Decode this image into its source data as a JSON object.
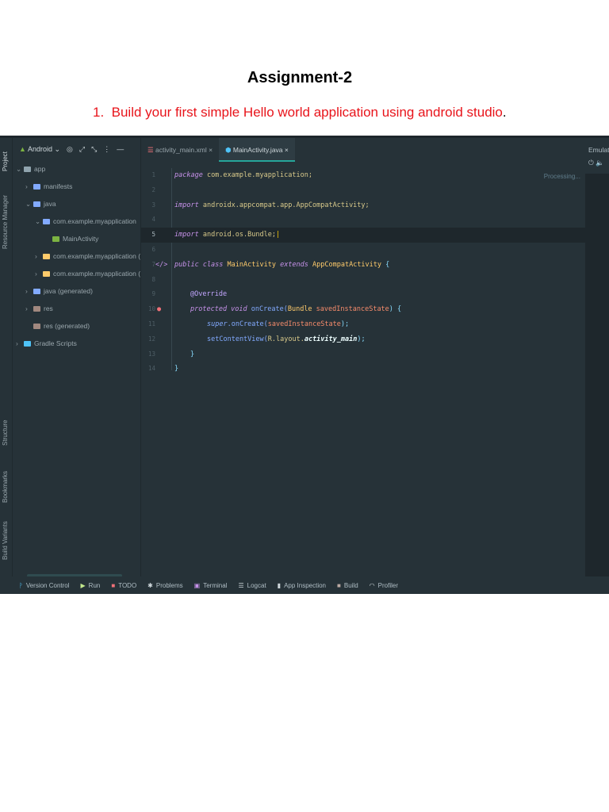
{
  "document": {
    "title": "Assignment-2",
    "task_number": "1.",
    "task_text": "Build your first simple Hello world application using android studio",
    "task_end": "."
  },
  "ide": {
    "left_strip": [
      "Project",
      "Resource Manager",
      "Structure",
      "Bookmarks",
      "Build Variants"
    ],
    "project_view": "Android",
    "tree": [
      {
        "label": "app",
        "depth": 0,
        "icon": "module",
        "color": "#90a4ae",
        "chev": "v"
      },
      {
        "label": "manifests",
        "depth": 1,
        "icon": "folder",
        "color": "#82aaff",
        "chev": ">"
      },
      {
        "label": "java",
        "depth": 1,
        "icon": "folder",
        "color": "#82aaff",
        "chev": "v"
      },
      {
        "label": "com.example.myapplication",
        "depth": 2,
        "icon": "package",
        "color": "#82aaff",
        "chev": "v"
      },
      {
        "label": "MainActivity",
        "depth": 3,
        "icon": "android",
        "color": "#7cb342",
        "chev": ""
      },
      {
        "label": "com.example.myapplication (",
        "depth": 2,
        "icon": "folder",
        "color": "#ffcb6b",
        "chev": ">"
      },
      {
        "label": "com.example.myapplication (",
        "depth": 2,
        "icon": "folder",
        "color": "#ffcb6b",
        "chev": ">"
      },
      {
        "label": "java (generated)",
        "depth": 1,
        "icon": "folder",
        "color": "#82aaff",
        "chev": ">"
      },
      {
        "label": "res",
        "depth": 1,
        "icon": "res-folder",
        "color": "#a1887f",
        "chev": ">"
      },
      {
        "label": "res (generated)",
        "depth": 1,
        "icon": "res-folder",
        "color": "#a1887f",
        "chev": ""
      },
      {
        "label": "Gradle Scripts",
        "depth": 0,
        "icon": "gradle",
        "color": "#4fc3f7",
        "chev": ">"
      }
    ],
    "tabs": [
      {
        "label": "activity_main.xml",
        "active": false
      },
      {
        "label": "MainActivity.java",
        "active": true
      }
    ],
    "status": "Processing...",
    "emulator": "Emulat",
    "code": {
      "l1": [
        "package",
        " com.example.myapplication;"
      ],
      "l3": [
        "import",
        " androidx.appcompat.app.AppCompatActivity;"
      ],
      "l5": [
        "import",
        " android.os.Bundle;"
      ],
      "l7": [
        "public class",
        " MainActivity ",
        "extends",
        " AppCompatActivity ",
        "{"
      ],
      "l9": "@Override",
      "l10": [
        "protected void",
        " onCreate(",
        "Bundle",
        " savedInstanceState",
        ") {"
      ],
      "l11": [
        "super",
        ".onCreate(",
        "savedInstanceState",
        ");"
      ],
      "l12": [
        "setContentView(",
        "R.layout.",
        "activity_main",
        ");"
      ],
      "l13": "}",
      "l14": "}"
    },
    "bottom": [
      {
        "icon": "version-control",
        "glyph": "ᚹ",
        "label": "Version Control",
        "color": "#4fc3f7"
      },
      {
        "icon": "run",
        "glyph": "▶",
        "label": "Run",
        "color": "#c3e88d"
      },
      {
        "icon": "todo",
        "glyph": "■",
        "label": "TODO",
        "color": "#f07178"
      },
      {
        "icon": "problems",
        "glyph": "✱",
        "label": "Problems",
        "color": "#cfd8dc"
      },
      {
        "icon": "terminal",
        "glyph": "▣",
        "label": "Terminal",
        "color": "#c792ea"
      },
      {
        "icon": "logcat",
        "glyph": "☰",
        "label": "Logcat",
        "color": "#cfd8dc"
      },
      {
        "icon": "app-inspection",
        "glyph": "▮",
        "label": "App Inspection",
        "color": "#cfd8dc"
      },
      {
        "icon": "build",
        "glyph": "■",
        "label": "Build",
        "color": "#bcaaa4"
      },
      {
        "icon": "profiler",
        "glyph": "◠",
        "label": "Profiler",
        "color": "#cfd8dc"
      }
    ]
  }
}
